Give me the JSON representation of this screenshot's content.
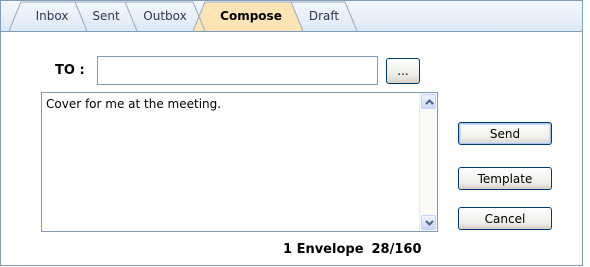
{
  "tabs": [
    {
      "label": "Inbox",
      "active": false
    },
    {
      "label": "Sent",
      "active": false
    },
    {
      "label": "Outbox",
      "active": false
    },
    {
      "label": "Compose",
      "active": true
    },
    {
      "label": "Draft",
      "active": false
    }
  ],
  "compose": {
    "to_label": "TO :",
    "to_value": "",
    "browse_label": "...",
    "message": "Cover for me at the meeting."
  },
  "actions": {
    "send": "Send",
    "template": "Template",
    "cancel": "Cancel"
  },
  "status": {
    "envelopes": "1 Envelope",
    "counter": "28/160"
  },
  "colors": {
    "active_tab": "#fde4b4",
    "border": "#7f9db9",
    "button_border": "#003c74"
  }
}
